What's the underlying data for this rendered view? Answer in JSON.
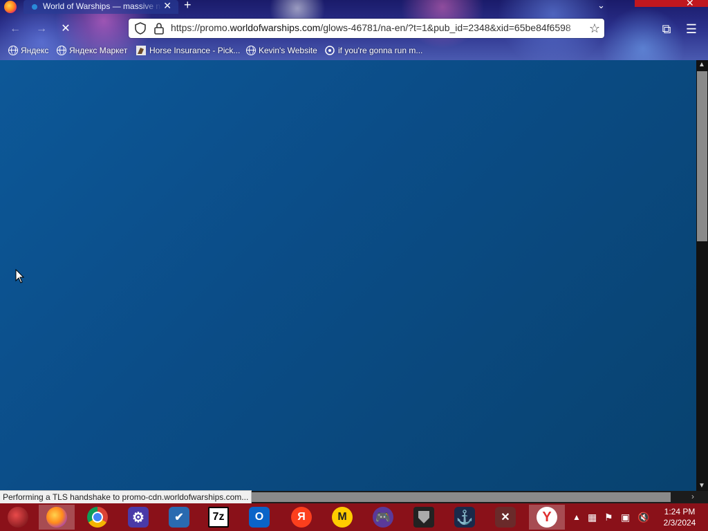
{
  "tab": {
    "title": "World of Warships — massive naval battles",
    "close": "✕"
  },
  "toolbar": {
    "new_tab": "+",
    "tab_list": "⌄",
    "window_close": "✕",
    "back": "←",
    "forward": "→",
    "reload": "✕",
    "extensions": "⧉",
    "menu": "☰"
  },
  "address_bar": {
    "url_prefix": "https://promo.",
    "url_domain": "worldofwarships.com",
    "url_suffix": "/glows-46781/na-en/?t=1&pub_id=2348&xid=65be84f6598",
    "star": "☆"
  },
  "bookmarks": [
    {
      "label": "Яндекс",
      "icon": "globe-icon"
    },
    {
      "label": "Яндекс Маркет",
      "icon": "globe-icon"
    },
    {
      "label": "Horse Insurance - Pick...",
      "icon": "horse-icon"
    },
    {
      "label": "Kevin's Website",
      "icon": "globe-icon"
    },
    {
      "label": "if you're gonna run m...",
      "icon": "custom-icon"
    }
  ],
  "status_text": "Performing a TLS handshake to promo-cdn.worldofwarships.com...",
  "taskbar": {
    "apps": [
      {
        "name": "start-button",
        "label": ""
      },
      {
        "name": "firefox",
        "label": ""
      },
      {
        "name": "chrome",
        "label": ""
      },
      {
        "name": "settings",
        "label": ""
      },
      {
        "name": "task-app",
        "label": ""
      },
      {
        "name": "7zip",
        "label": "7z"
      },
      {
        "name": "outlook",
        "label": "O"
      },
      {
        "name": "yandex",
        "label": "Я"
      },
      {
        "name": "yandex-market",
        "label": "M"
      },
      {
        "name": "game-controller",
        "label": ""
      },
      {
        "name": "world-of-tanks",
        "label": ""
      },
      {
        "name": "world-of-warships",
        "label": "⚓"
      },
      {
        "name": "game-app",
        "label": ""
      },
      {
        "name": "yandex-browser",
        "label": "Y"
      }
    ],
    "tray_arrow": "▲",
    "time": "1:24 PM",
    "date": "2/3/2024"
  },
  "colors": {
    "page_background": "#0b4d88",
    "taskbar": "#8a1119",
    "window_close": "#c0171f"
  }
}
